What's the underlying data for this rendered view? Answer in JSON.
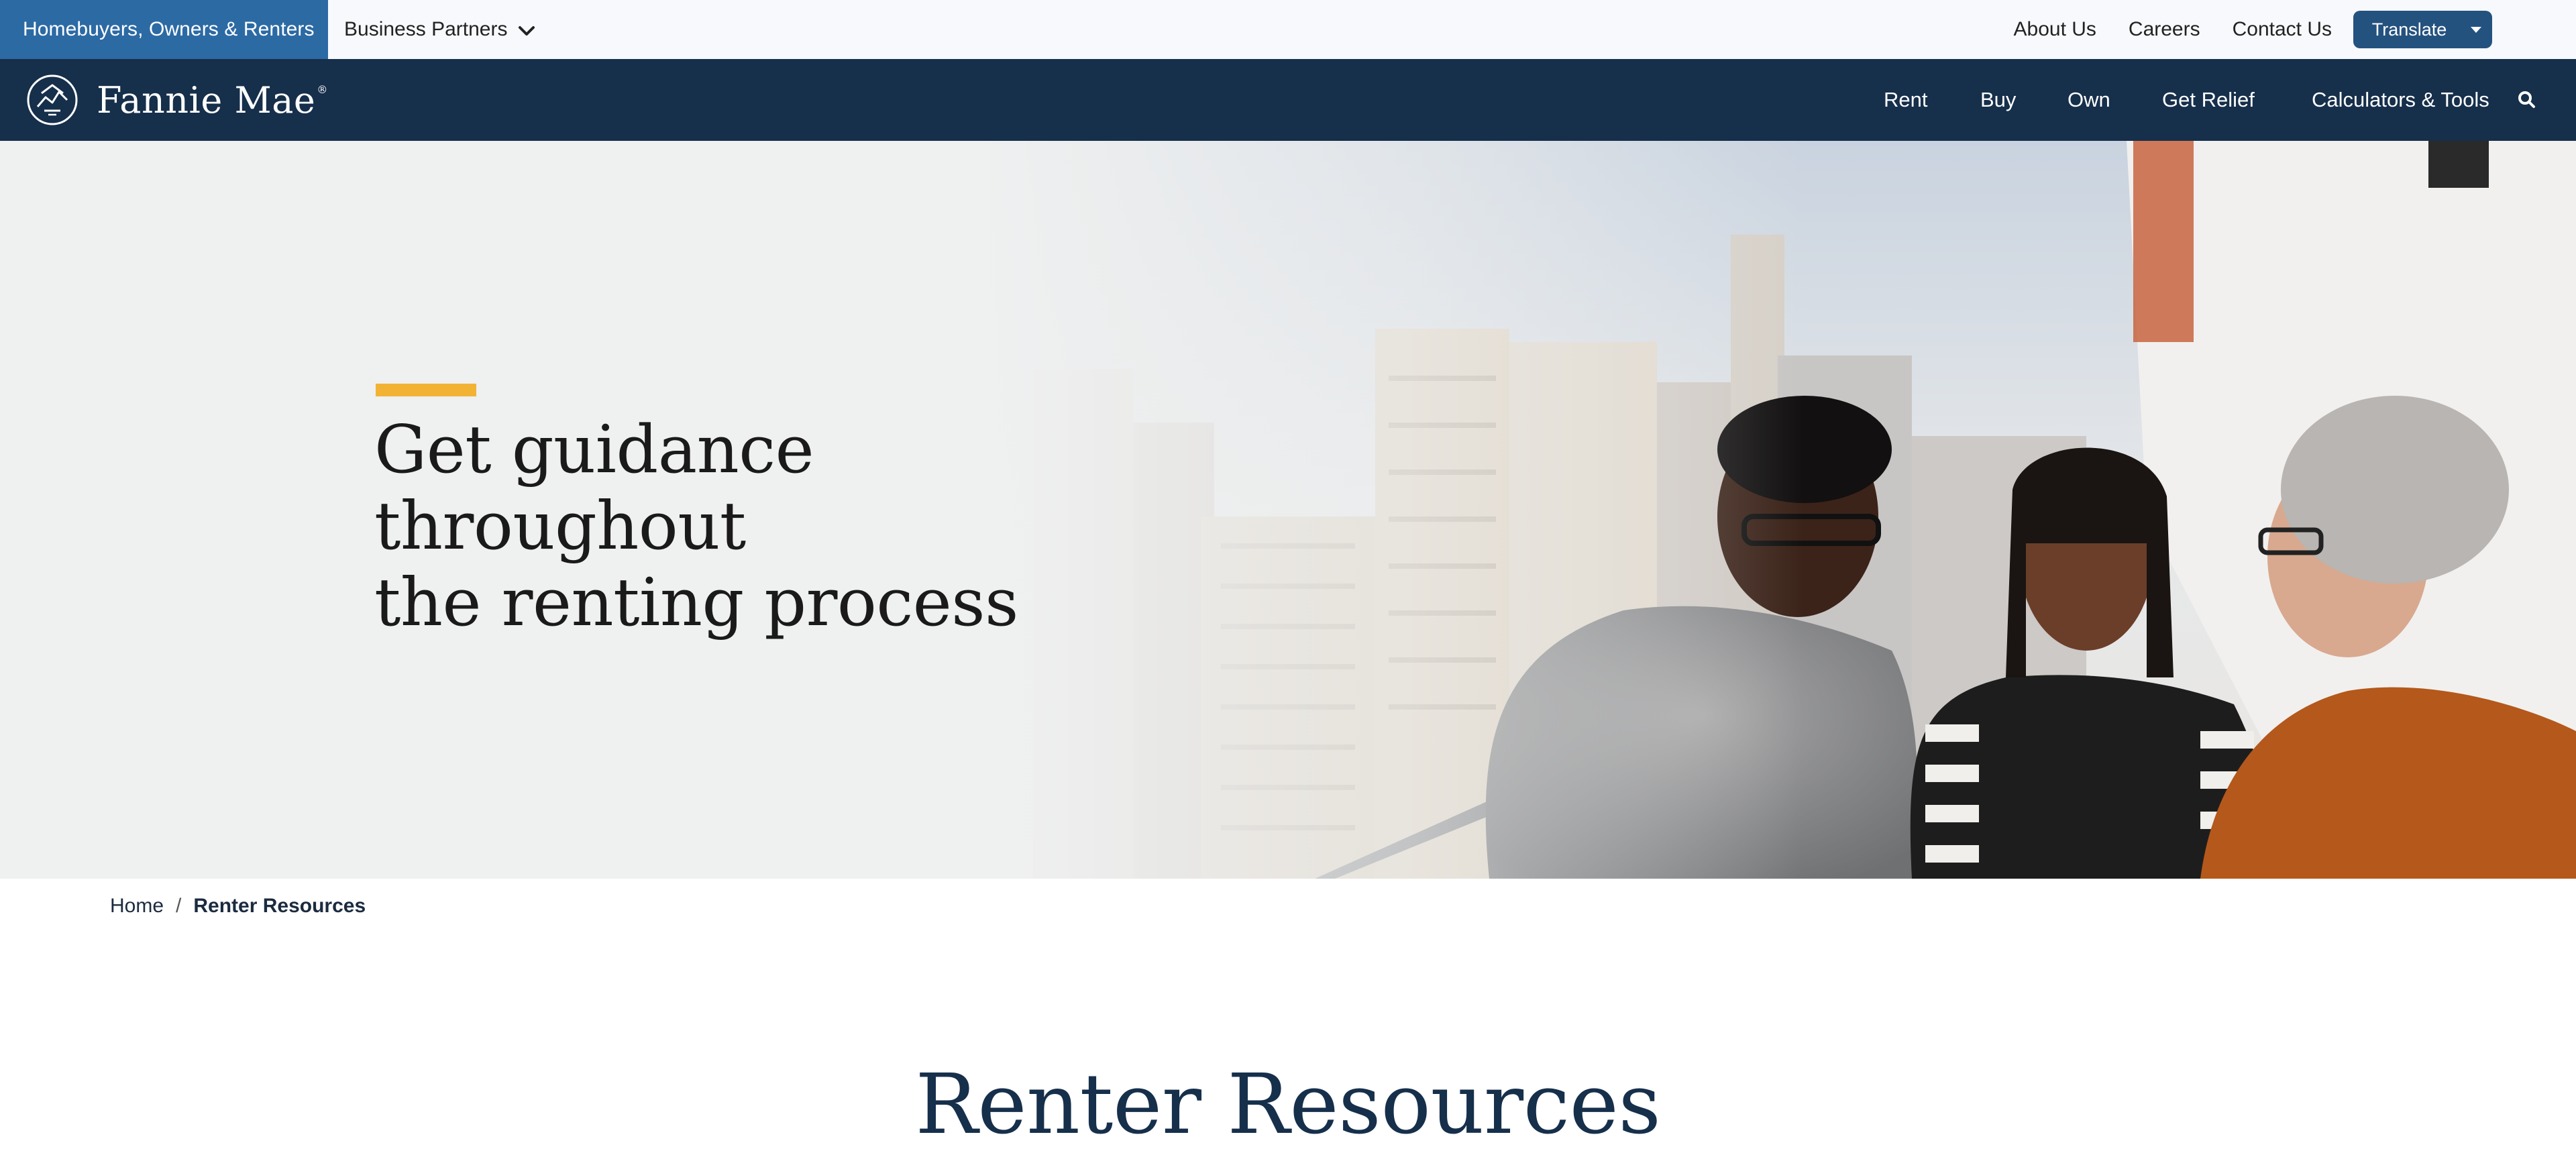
{
  "utility": {
    "audience_active": "Homebuyers, Owners & Renters",
    "audience_partners": "Business Partners",
    "links": [
      "About Us",
      "Careers",
      "Contact Us"
    ],
    "translate_label": "Translate"
  },
  "brand": {
    "name": "Fannie Mae",
    "registered_mark": "®",
    "nav_color": "#162f4b",
    "accent": "#f2b335",
    "audience_color": "#2c6aa4"
  },
  "nav": {
    "items": [
      "Rent",
      "Buy",
      "Own",
      "Get Relief",
      "Calculators & Tools"
    ],
    "search_icon": "search-icon"
  },
  "hero": {
    "line1": "Get guidance throughout",
    "line2": "the renting process"
  },
  "breadcrumb": {
    "home": "Home",
    "separator": "/",
    "current": "Renter Resources"
  },
  "section": {
    "title": "Renter Resources"
  }
}
